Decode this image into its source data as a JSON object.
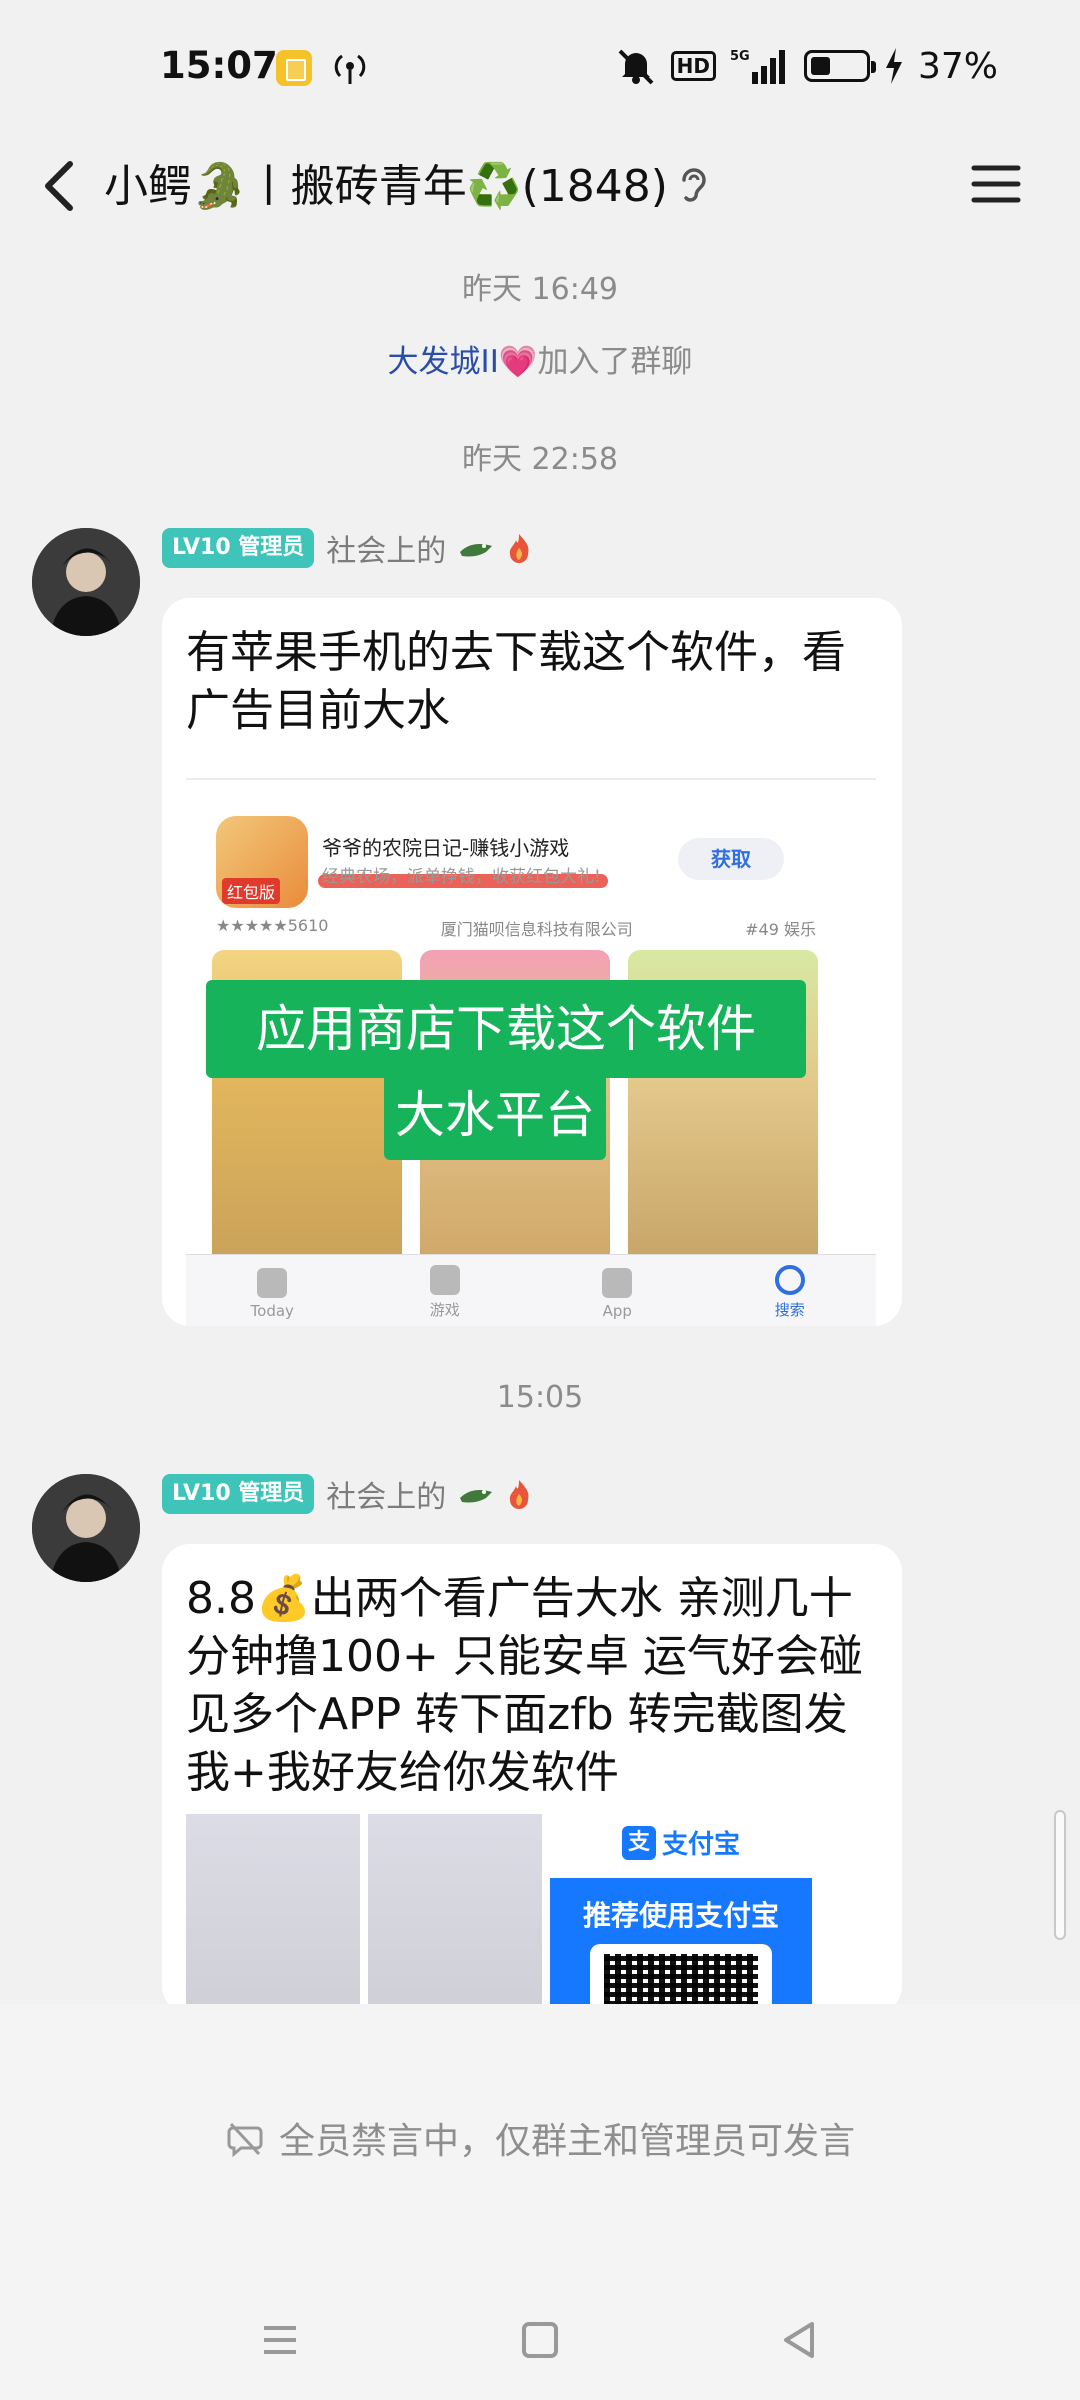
{
  "status_bar": {
    "time": "15:07",
    "battery_percent": "37%",
    "battery_level": 0.37,
    "network": "5G"
  },
  "header": {
    "title": "小鳄🐊丨搬砖青年♻️(1848)"
  },
  "chat": {
    "time_1": "昨天 16:49",
    "system_name": "大发城II💗",
    "system_text": "加入了群聊",
    "time_2": "昨天 22:58",
    "time_3": "15:05",
    "messages": [
      {
        "badge": "LV10 管理员",
        "sender": "社会上的",
        "text": "有苹果手机的去下载这个软件，看广告目前大水",
        "ad": {
          "app_name": "爷爷的农院日记-赚钱小游戏",
          "app_sub": "经典农场，派单挣钱，收获红包大礼!",
          "get_label": "获取",
          "icon_tag": "红包版",
          "rating": "★★★★★5610",
          "developer": "厦门猫呗信息科技有限公司",
          "rank": "#49 娱乐",
          "banner_1": "应用商店下载这个软件",
          "banner_2": "大水平台",
          "tabs": [
            "Today",
            "游戏",
            "App",
            "搜索"
          ]
        }
      },
      {
        "badge": "LV10 管理员",
        "sender": "社会上的",
        "text": "8.8💰出两个看广告大水 亲测几十分钟撸100+ 只能安卓 运气好会碰见多个APP 转下面zfb 转完截图发我+我好友给你发软件",
        "alipay": {
          "logo_text": "支付宝",
          "band_text": "推荐使用支付宝"
        }
      }
    ]
  },
  "bottom": {
    "muted_notice": "全员禁言中，仅群主和管理员可发言"
  },
  "colors": {
    "badge": "#3ec4b8",
    "link_name": "#2a4ea8",
    "green_banner": "#17b35a",
    "alipay_blue": "#1677ff"
  },
  "icons": [
    "back-icon",
    "menu-icon",
    "ear-icon",
    "croc-icon",
    "fire-icon",
    "mute-icon",
    "signal-icon",
    "battery-icon",
    "home-icon",
    "recent-icon",
    "back-nav-icon"
  ]
}
